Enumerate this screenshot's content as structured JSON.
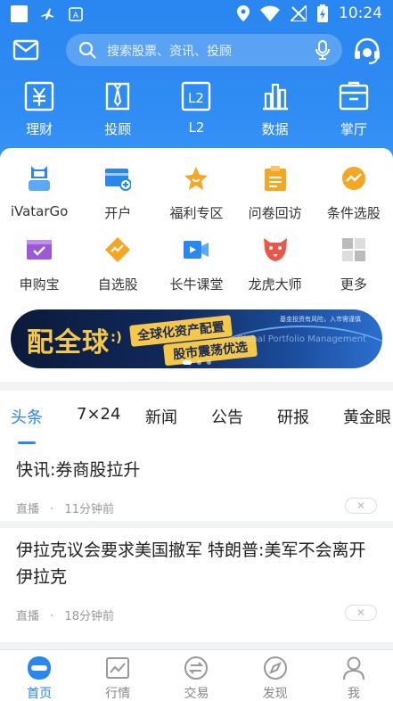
{
  "status_bar": {
    "time": "10:24"
  },
  "header": {
    "search_placeholder": "搜索股票、资讯、投顾"
  },
  "top_nav": [
    {
      "label": "理财",
      "icon": "wealth-icon"
    },
    {
      "label": "投顾",
      "icon": "advisor-icon"
    },
    {
      "label": "L2",
      "icon": "l2-icon"
    },
    {
      "label": "数据",
      "icon": "data-chart-icon"
    },
    {
      "label": "掌厅",
      "icon": "hall-icon"
    }
  ],
  "services": [
    {
      "label": "iVatarGo",
      "icon": "robot-icon"
    },
    {
      "label": "开户",
      "icon": "card-icon"
    },
    {
      "label": "福利专区",
      "icon": "star-icon"
    },
    {
      "label": "问卷回访",
      "icon": "clipboard-icon"
    },
    {
      "label": "条件选股",
      "icon": "trend-icon"
    },
    {
      "label": "申购宝",
      "icon": "envelope-check-icon"
    },
    {
      "label": "自选股",
      "icon": "diamond-icon"
    },
    {
      "label": "长牛课堂",
      "icon": "video-icon"
    },
    {
      "label": "龙虎大师",
      "icon": "tiger-icon"
    },
    {
      "label": "更多",
      "icon": "grid-icon"
    }
  ],
  "banner": {
    "headline": "配全球",
    "smile": ":)",
    "tag1": "全球化资产配置",
    "tag2": "股市震荡优选",
    "risk_note": "基金投资有风险，入市需谨慎",
    "english": "Global Portfolio Management"
  },
  "news": {
    "tabs": [
      "头条",
      "7×24",
      "新闻",
      "公告",
      "研报",
      "黄金眼"
    ],
    "active_tab": "头条",
    "articles": [
      {
        "title": "快讯:券商股拉升",
        "source": "直播",
        "time": "11分钟前"
      },
      {
        "title": "伊拉克议会要求美国撤军 特朗普:美军不会离开伊拉克",
        "source": "直播",
        "time": "18分钟前"
      }
    ],
    "separator": "·",
    "close_glyph": "✕"
  },
  "bottom_nav": [
    {
      "label": "首页",
      "icon": "home-icon",
      "active": true
    },
    {
      "label": "行情",
      "icon": "market-icon"
    },
    {
      "label": "交易",
      "icon": "trade-icon"
    },
    {
      "label": "发现",
      "icon": "compass-icon"
    },
    {
      "label": "我",
      "icon": "profile-icon"
    }
  ],
  "colors": {
    "primary": "#2a86f0",
    "gold": "#f6c84a"
  }
}
